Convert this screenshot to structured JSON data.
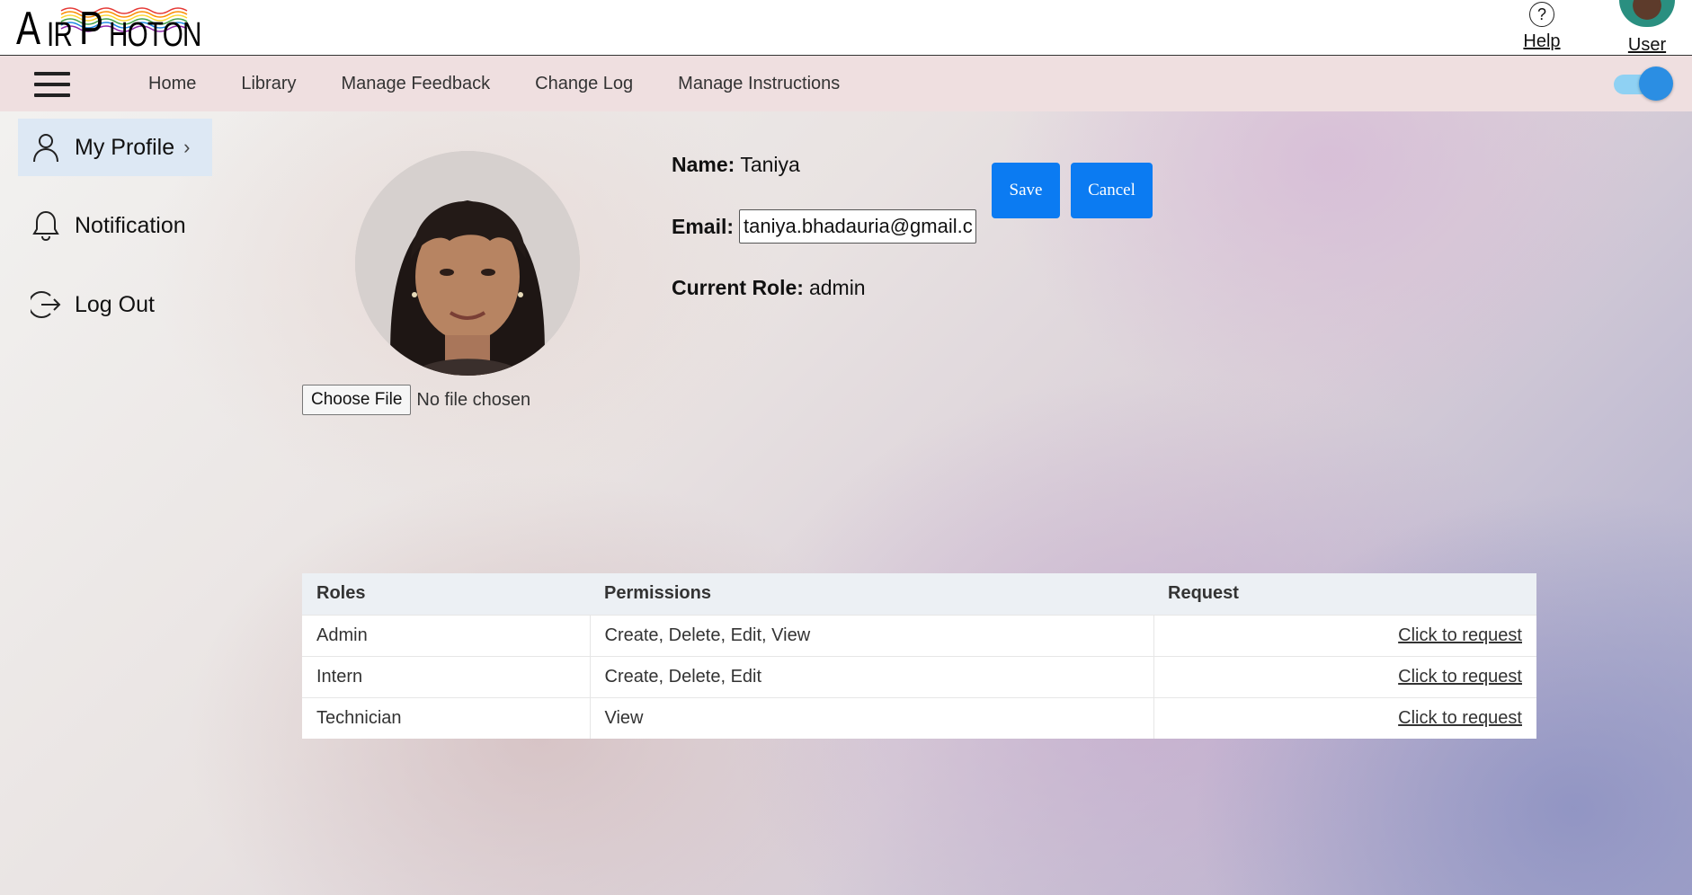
{
  "header": {
    "logo": "AIRPHOTON",
    "help_label": "Help",
    "user_label": "User"
  },
  "nav": {
    "items": [
      {
        "label": "Home"
      },
      {
        "label": "Library"
      },
      {
        "label": "Manage Feedback"
      },
      {
        "label": "Change Log"
      },
      {
        "label": "Manage Instructions"
      }
    ],
    "theme_toggle_on": true
  },
  "sidebar": {
    "items": [
      {
        "label": "My Profile",
        "active": true
      },
      {
        "label": "Notification",
        "active": false
      },
      {
        "label": "Log Out",
        "active": false
      }
    ]
  },
  "profile": {
    "name_label": "Name:",
    "name": "Taniya",
    "email_label": "Email:",
    "email": "taniya.bhadauria@gmail.com",
    "role_label": "Current Role:",
    "role": "admin",
    "choose_file_label": "Choose File",
    "file_status": "No file chosen",
    "save_label": "Save",
    "cancel_label": "Cancel"
  },
  "roles_table": {
    "headers": [
      "Roles",
      "Permissions",
      "Request"
    ],
    "rows": [
      {
        "role": "Admin",
        "permissions": "Create, Delete, Edit, View",
        "request": "Click to request"
      },
      {
        "role": "Intern",
        "permissions": "Create, Delete, Edit",
        "request": "Click to request"
      },
      {
        "role": "Technician",
        "permissions": "View",
        "request": "Click to request"
      }
    ]
  },
  "colors": {
    "accent": "#0b7bf2",
    "navbar_bg": "#efdfe0",
    "active_sidebar_bg": "#dde8f4",
    "toggle_knob": "#2b8ee3",
    "toggle_track": "#8fd1f3"
  }
}
